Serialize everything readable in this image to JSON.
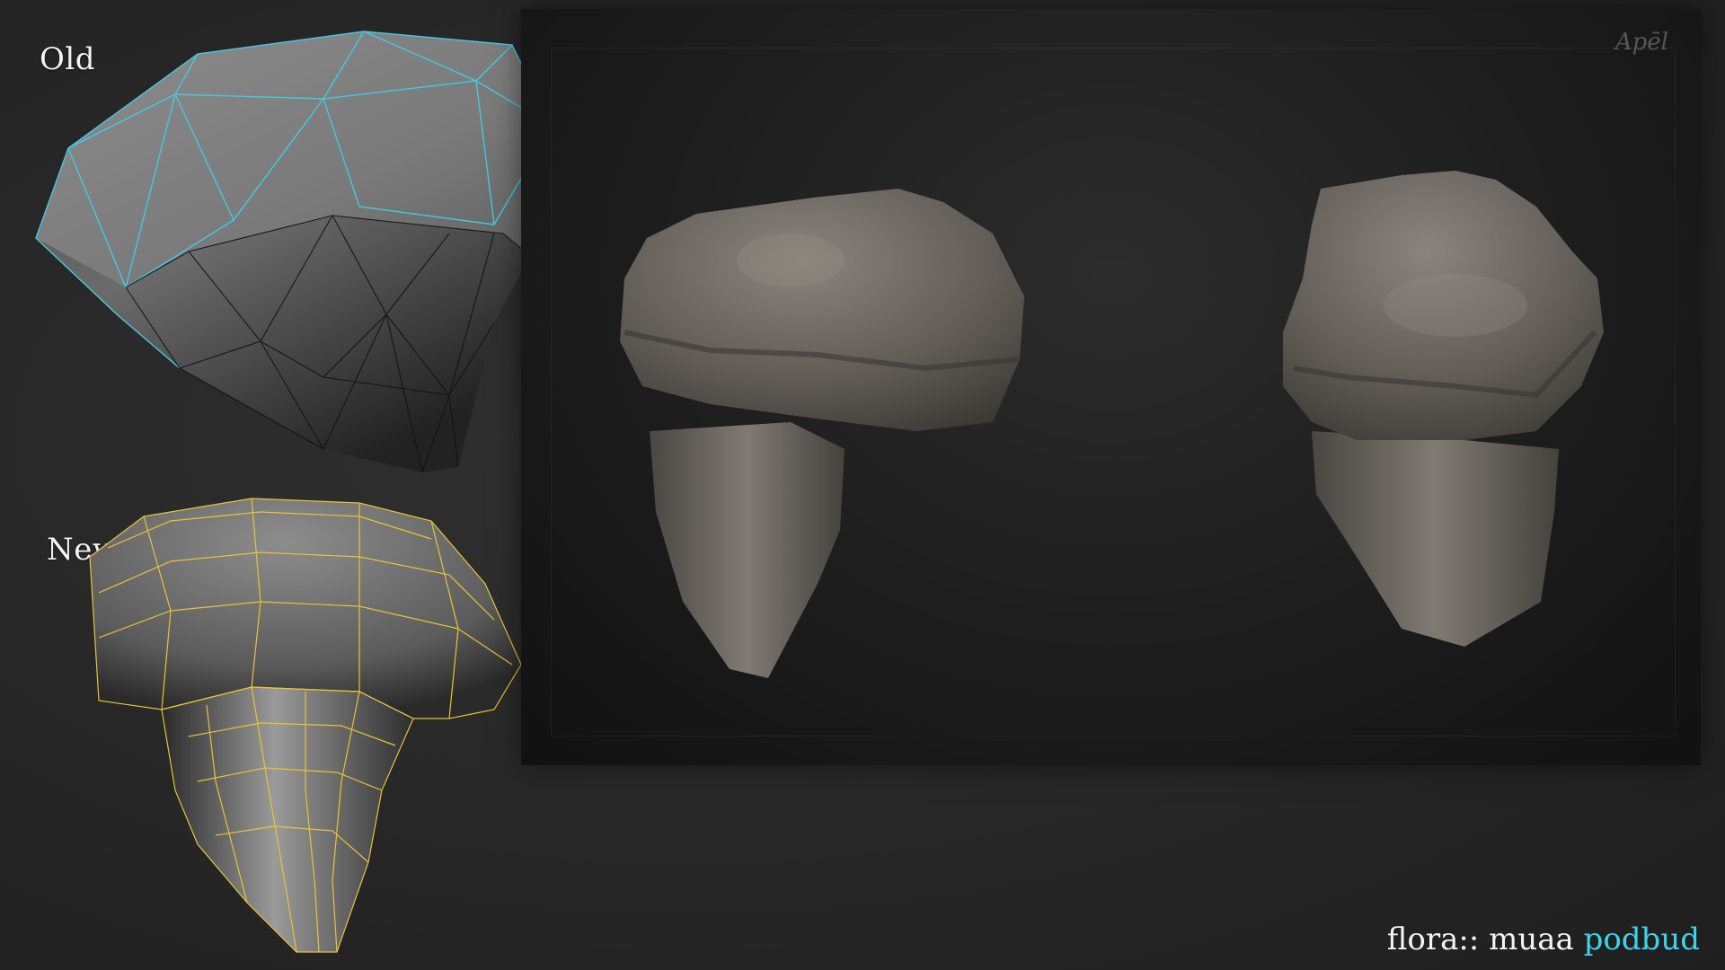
{
  "labels": {
    "old": "Old",
    "new": "New"
  },
  "render": {
    "signature": "Apēl"
  },
  "caption": {
    "prefix": "flora:: muaa ",
    "accent": "podbud"
  },
  "colors": {
    "old_wire": "#45c8e0",
    "new_wire": "#e8c23a",
    "caption_accent": "#3fd3ea",
    "sculpt": "#6e6a65"
  }
}
